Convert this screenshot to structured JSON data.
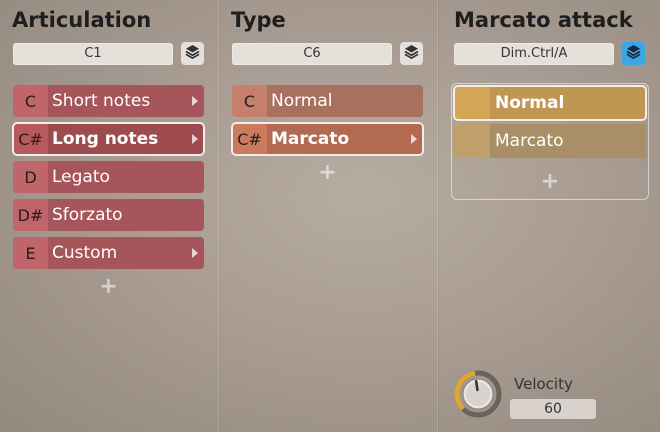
{
  "colors": {
    "articulation": "#c0666a",
    "type": "#c67f6a",
    "attack": "#d2a654",
    "layers_active": "#3aa6e6"
  },
  "columns": [
    {
      "title": "Articulation",
      "key": "C1",
      "items": [
        {
          "key": "C",
          "label": "Short notes",
          "has_arrow": true,
          "selected": false
        },
        {
          "key": "C#",
          "label": "Long notes",
          "has_arrow": true,
          "selected": true
        },
        {
          "key": "D",
          "label": "Legato",
          "has_arrow": false,
          "selected": false
        },
        {
          "key": "D#",
          "label": "Sforzato",
          "has_arrow": false,
          "selected": false
        },
        {
          "key": "E",
          "label": "Custom",
          "has_arrow": true,
          "selected": false
        }
      ],
      "add_label": "+"
    },
    {
      "title": "Type",
      "key": "C6",
      "items": [
        {
          "key": "C",
          "label": "Normal",
          "has_arrow": false,
          "selected": false
        },
        {
          "key": "C#",
          "label": "Marcato",
          "has_arrow": true,
          "selected": true
        }
      ],
      "add_label": "+"
    },
    {
      "title": "Marcato attack",
      "key": "Dim.Ctrl/A",
      "items": [
        {
          "label": "Normal",
          "selected": true
        },
        {
          "label": "Marcato",
          "selected": false
        }
      ],
      "add_label": "+"
    }
  ],
  "velocity": {
    "label": "Velocity",
    "value": "60",
    "knob_fraction": 0.47
  }
}
